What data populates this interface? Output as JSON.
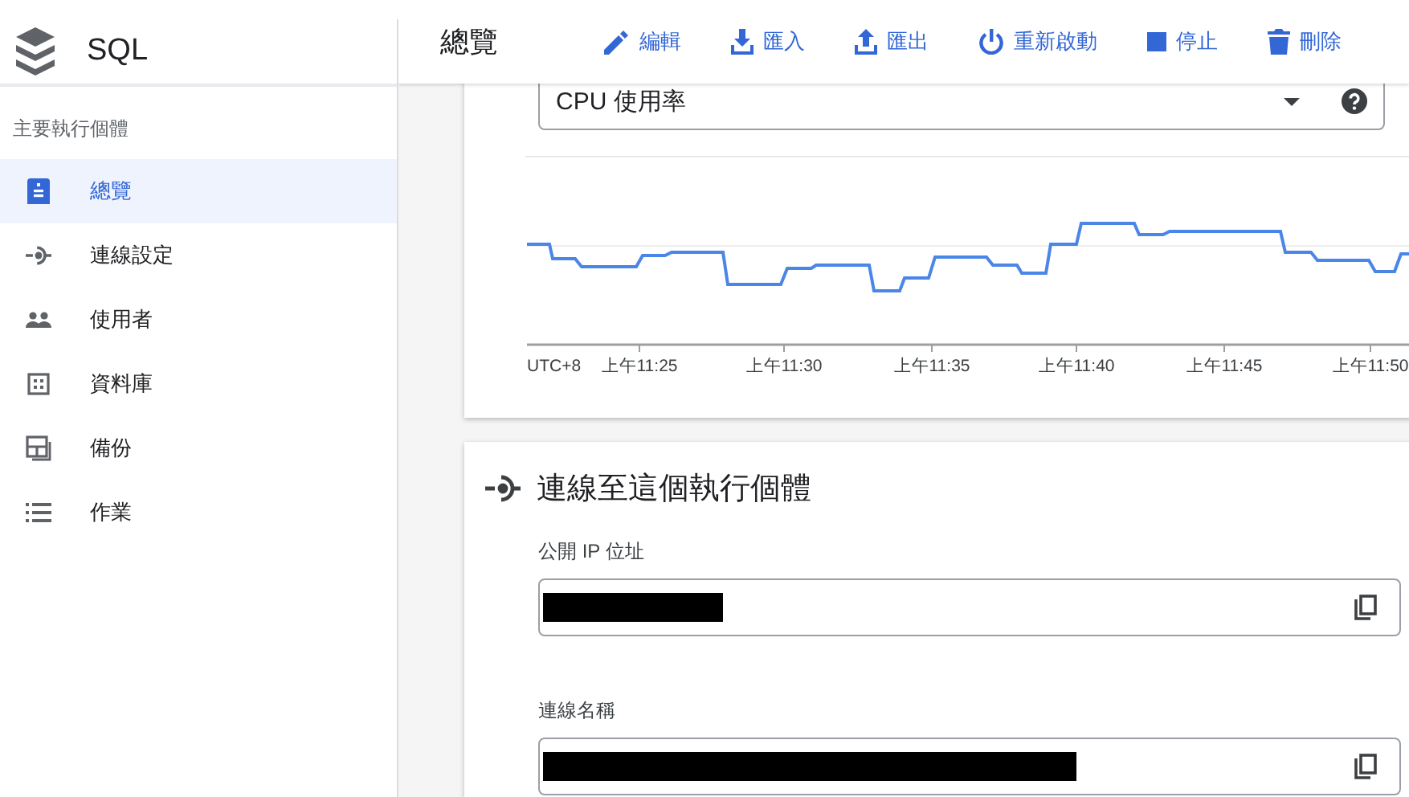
{
  "app": {
    "title": "SQL"
  },
  "sidebar": {
    "section": "主要執行個體",
    "items": [
      {
        "label": "總覽",
        "selected": true
      },
      {
        "label": "連線設定",
        "selected": false
      },
      {
        "label": "使用者",
        "selected": false
      },
      {
        "label": "資料庫",
        "selected": false
      },
      {
        "label": "備份",
        "selected": false
      },
      {
        "label": "作業",
        "selected": false
      }
    ]
  },
  "header": {
    "title": "總覽",
    "actions": [
      "編輯",
      "匯入",
      "匯出",
      "重新啟動",
      "停止",
      "刪除"
    ]
  },
  "metrics_card": {
    "metric_select": {
      "value": "CPU 使用率"
    },
    "chart": {
      "x_labels": [
        "UTC+8",
        "上午11:25",
        "上午11:30",
        "上午11:35",
        "上午11:40",
        "上午11:45",
        "上午11:50"
      ]
    }
  },
  "connect_card": {
    "title": "連線至這個執行個體",
    "fields": [
      {
        "label": "公開 IP 位址",
        "redacted": true
      },
      {
        "label": "連線名稱",
        "redacted": true
      }
    ]
  }
}
